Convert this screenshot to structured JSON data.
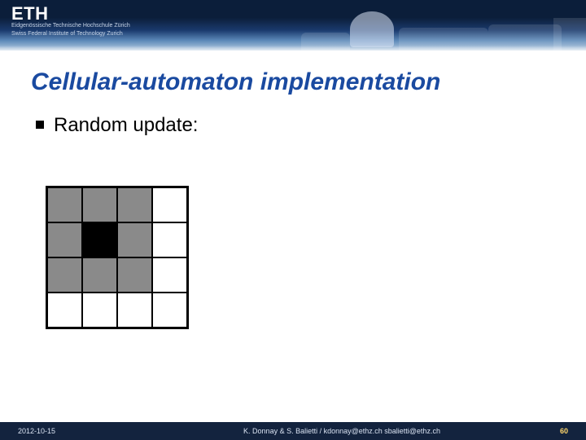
{
  "header": {
    "logo_text": "ETH",
    "sub_line1": "Eidgenössische Technische Hochschule Zürich",
    "sub_line2": "Swiss Federal Institute of Technology Zurich"
  },
  "title": "Cellular-automaton implementation",
  "bullet": {
    "text": "Random update:"
  },
  "grid": {
    "rows": 4,
    "cols": 4,
    "cells": [
      [
        "grey",
        "grey",
        "grey",
        "white"
      ],
      [
        "grey",
        "black",
        "grey",
        "white"
      ],
      [
        "grey",
        "grey",
        "grey",
        "white"
      ],
      [
        "white",
        "white",
        "white",
        "white"
      ]
    ]
  },
  "footer": {
    "date": "2012-10-15",
    "credits": "K. Donnay & S. Balietti / kdonnay@ethz.ch   sbalietti@ethz.ch",
    "page_number": "60"
  }
}
